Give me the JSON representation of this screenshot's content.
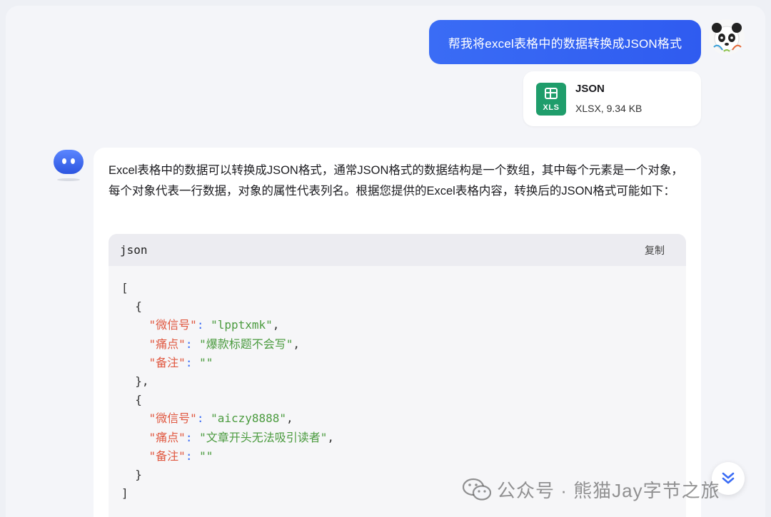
{
  "conversation": {
    "user_message": "帮我将excel表格中的数据转换成JSON格式",
    "attachment": {
      "name": "JSON",
      "meta": "XLSX, 9.34 KB",
      "icon_label": "XLS",
      "icon": "spreadsheet-icon",
      "color": "#1f9d6b"
    },
    "bot_text": "Excel表格中的数据可以转换成JSON格式，通常JSON格式的数据结构是一个数组，其中每个元素是一个对象，每个对象代表一行数据，对象的属性代表列名。根据您提供的Excel表格内容，转换后的JSON格式可能如下：",
    "code": {
      "lang": "json",
      "copy_label": "复制",
      "records": [
        {
          "k1": "微信号",
          "v1": "lpptxmk",
          "k2": "痛点",
          "v2": "爆款标题不会写",
          "k3": "备注",
          "v3": ""
        },
        {
          "k1": "微信号",
          "v1": "aiczy8888",
          "k2": "痛点",
          "v2": "文章开头无法吸引读者",
          "k3": "备注",
          "v3": ""
        }
      ]
    }
  },
  "watermark": "公众号 · 熊猫Jay字节之旅",
  "colors": {
    "accent": "#3a6cf5",
    "json_key": "#e0573f",
    "json_string": "#4b9b3f"
  }
}
